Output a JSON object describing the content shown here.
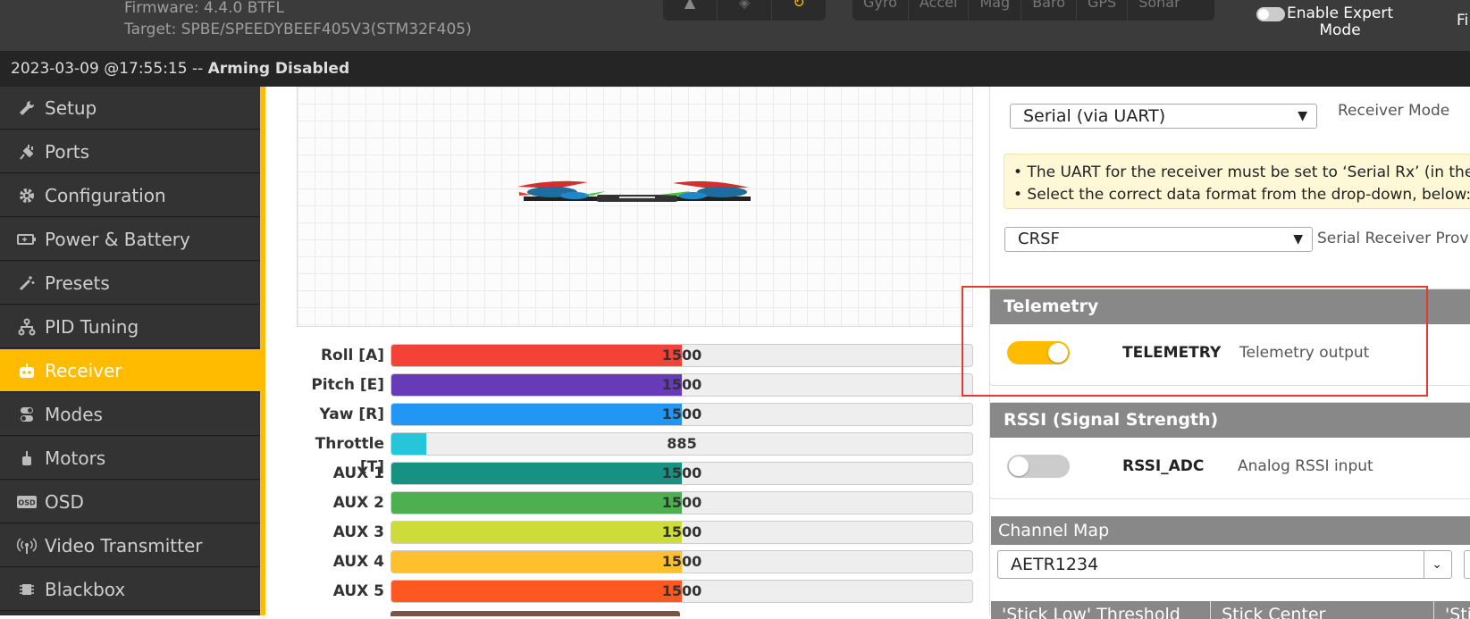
{
  "header": {
    "firmware": "Firmware: 4.4.0 BTFL",
    "target": "Target: SPBE/SPEEDYBEEF405V3(STM32F405)",
    "sensors": [
      "Gyro",
      "Accel",
      "Mag",
      "Baro",
      "GPS",
      "Sonar"
    ],
    "expert_mode_label_1": "Enable Expert",
    "expert_mode_label_2": "Mode",
    "cutoff_text": "Fi"
  },
  "status": {
    "timestamp": "2023-03-09 @17:55:15 -- ",
    "arming": "Arming Disabled"
  },
  "sidebar": {
    "items": [
      {
        "label": "Setup",
        "icon": "wrench-icon"
      },
      {
        "label": "Ports",
        "icon": "plug-icon"
      },
      {
        "label": "Configuration",
        "icon": "gear-icon"
      },
      {
        "label": "Power & Battery",
        "icon": "battery-icon"
      },
      {
        "label": "Presets",
        "icon": "magic-wand-icon"
      },
      {
        "label": "PID Tuning",
        "icon": "sliders-icon"
      },
      {
        "label": "Receiver",
        "icon": "robot-icon",
        "active": true
      },
      {
        "label": "Modes",
        "icon": "toggle-icon"
      },
      {
        "label": "Motors",
        "icon": "motor-icon"
      },
      {
        "label": "OSD",
        "icon": "osd-icon"
      },
      {
        "label": "Video Transmitter",
        "icon": "antenna-icon"
      },
      {
        "label": "Blackbox",
        "icon": "chip-icon"
      }
    ]
  },
  "channels": [
    {
      "label": "Roll [A]",
      "value": "1500",
      "fraction": 0.5,
      "color": "#f44336"
    },
    {
      "label": "Pitch [E]",
      "value": "1500",
      "fraction": 0.5,
      "color": "#673ab7"
    },
    {
      "label": "Yaw [R]",
      "value": "1500",
      "fraction": 0.5,
      "color": "#2196f3"
    },
    {
      "label": "Throttle [T]",
      "value": "885",
      "fraction": 0.06,
      "color": "#26c6da"
    },
    {
      "label": "AUX 1",
      "value": "1500",
      "fraction": 0.5,
      "color": "#169182"
    },
    {
      "label": "AUX 2",
      "value": "1500",
      "fraction": 0.5,
      "color": "#4caf50"
    },
    {
      "label": "AUX 3",
      "value": "1500",
      "fraction": 0.5,
      "color": "#cddc39"
    },
    {
      "label": "AUX 4",
      "value": "1500",
      "fraction": 0.5,
      "color": "#ffc02e"
    },
    {
      "label": "AUX 5",
      "value": "1500",
      "fraction": 0.5,
      "color": "#ff5722"
    }
  ],
  "receiver": {
    "mode_value": "Serial (via UART)",
    "mode_label": "Receiver Mode",
    "note_1": "• The UART for the receiver must be set to ‘Serial Rx’ (in the Po",
    "note_2": "• Select the correct data format from the drop-down, below:",
    "provider_value": "CRSF",
    "provider_label": "Serial Receiver Provid"
  },
  "telemetry": {
    "title": "Telemetry",
    "name": "TELEMETRY",
    "desc": "Telemetry output",
    "on": true
  },
  "rssi": {
    "title": "RSSI (Signal Strength)",
    "name": "RSSI_ADC",
    "desc": "Analog RSSI input",
    "on": false
  },
  "channel_map": {
    "title": "Channel Map",
    "value": "AETR1234"
  },
  "stick": {
    "headers": [
      "'Stick Low' Threshold",
      "Stick Center",
      "'Sti"
    ]
  },
  "colors": {
    "accent": "#ffbb00",
    "toggle_on": "#ffbb00",
    "highlight": "#e53935"
  }
}
